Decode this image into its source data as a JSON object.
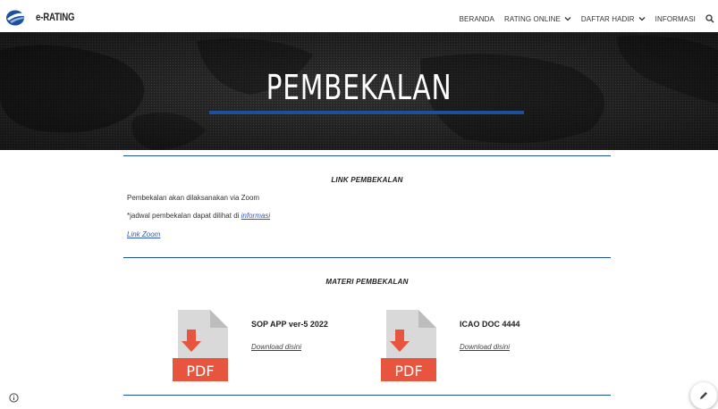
{
  "header": {
    "brand": "e-RATING",
    "nav": [
      {
        "label": "BERANDA",
        "dropdown": false
      },
      {
        "label": "RATING ONLINE",
        "dropdown": true
      },
      {
        "label": "DAFTAR HADIR",
        "dropdown": true
      },
      {
        "label": "INFORMASI",
        "dropdown": false
      }
    ],
    "search_icon": "search-icon"
  },
  "hero": {
    "title": "PEMBEKALAN",
    "accent_color": "#1d4f9c"
  },
  "link_section": {
    "title": "LINK PEMBEKALAN",
    "line1": "Pembekalan akan dilaksanakan via Zoom",
    "line2_prefix": "*jadwal pembekalan dapat dilihat di ",
    "line2_link": "informasi",
    "zoom_link": "Link Zoom"
  },
  "materi_section": {
    "title": "MATERI PEMBEKALAN",
    "documents": [
      {
        "icon": "pdf-icon",
        "icon_label": "PDF",
        "title": "SOP APP ver-5 2022",
        "download_label": "Download disini"
      },
      {
        "icon": "pdf-icon",
        "icon_label": "PDF",
        "title": "ICAO DOC 4444",
        "download_label": "Download disini"
      }
    ]
  },
  "footer": {
    "info_icon": "info-icon",
    "edit_icon": "pencil-icon"
  },
  "colors": {
    "accent": "#1d4f9c",
    "link": "#2f58c5",
    "pdf_red": "#e8553e",
    "pdf_gray": "#d9d9d9"
  }
}
